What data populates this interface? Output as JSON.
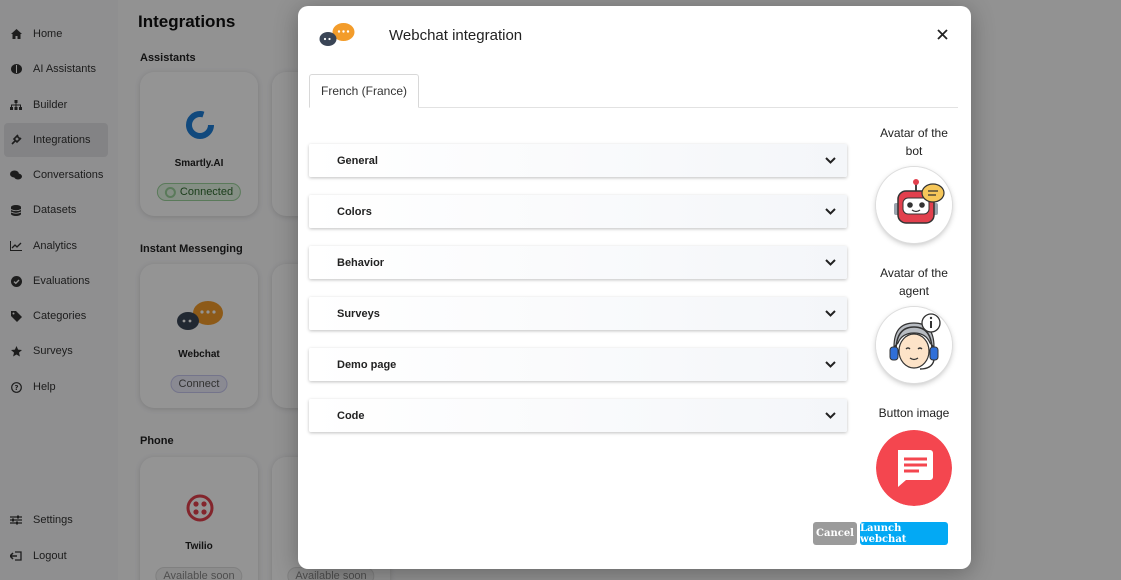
{
  "sidebar": {
    "items": [
      {
        "label": "Home",
        "icon": "home-icon"
      },
      {
        "label": "AI Assistants",
        "icon": "brain-icon"
      },
      {
        "label": "Builder",
        "icon": "sitemap-icon"
      },
      {
        "label": "Integrations",
        "icon": "plug-icon",
        "active": true
      },
      {
        "label": "Conversations",
        "icon": "comments-icon"
      },
      {
        "label": "Datasets",
        "icon": "database-icon"
      },
      {
        "label": "Analytics",
        "icon": "chart-line-icon"
      },
      {
        "label": "Evaluations",
        "icon": "check-circle-icon"
      },
      {
        "label": "Categories",
        "icon": "tag-icon"
      },
      {
        "label": "Surveys",
        "icon": "star-icon"
      },
      {
        "label": "Help",
        "icon": "question-circle-icon"
      }
    ],
    "bottom": [
      {
        "label": "Settings",
        "icon": "sliders-icon"
      },
      {
        "label": "Logout",
        "icon": "logout-icon"
      }
    ]
  },
  "main": {
    "title": "Integrations",
    "sections": {
      "assistants": "Assistants",
      "instant_messenging": "Instant Messenging",
      "phone": "Phone"
    },
    "cards": {
      "smartly": {
        "name": "Smartly.AI",
        "status": "Connected"
      },
      "webchat": {
        "name": "Webchat",
        "status": "Connect"
      },
      "twilio": {
        "name": "Twilio",
        "status": "Available soon"
      },
      "phone2": {
        "status": "Available soon"
      }
    }
  },
  "modal": {
    "title": "Webchat integration",
    "tab": "French (France)",
    "sections": [
      "General",
      "Colors",
      "Behavior",
      "Surveys",
      "Demo page",
      "Code"
    ],
    "avatar_bot_label": "Avatar of the bot",
    "avatar_agent_label": "Avatar of the agent",
    "button_image_label": "Button image",
    "cancel_label": "Cancel",
    "launch_label": "Launch webchat"
  },
  "colors": {
    "accent_blue": "#03a9f4",
    "button_image_red": "#f4464f",
    "cancel_grey": "#9b9b9b",
    "logo_orange": "#f39c2a",
    "logo_navy": "#3a4556"
  }
}
